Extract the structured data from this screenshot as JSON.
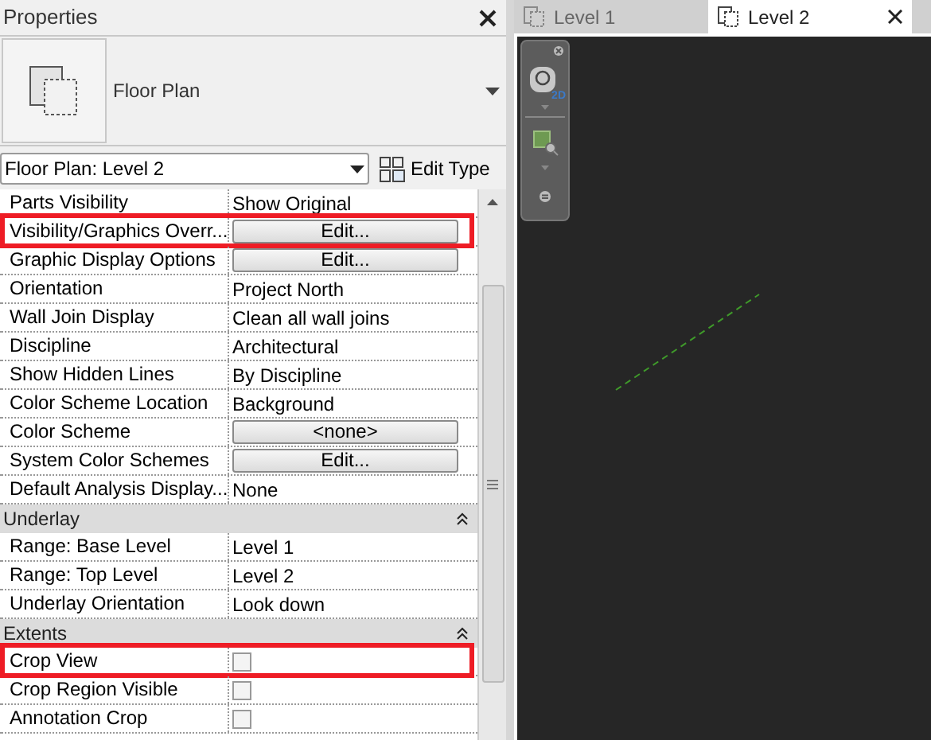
{
  "properties_panel": {
    "title": "Properties",
    "type_selector": {
      "label": "Floor Plan"
    },
    "instance_dropdown": {
      "value": "Floor Plan: Level 2"
    },
    "edit_type": "Edit Type",
    "sections": [
      {
        "rows": [
          {
            "name": "Parts Visibility",
            "kind": "text",
            "value": "Show Original",
            "highlighted": false
          },
          {
            "name": "Visibility/Graphics Overr...",
            "kind": "button",
            "value": "Edit...",
            "highlighted": true
          },
          {
            "name": "Graphic Display Options",
            "kind": "button",
            "value": "Edit...",
            "highlighted": false
          },
          {
            "name": "Orientation",
            "kind": "text",
            "value": "Project North",
            "highlighted": false
          },
          {
            "name": "Wall Join Display",
            "kind": "text",
            "value": "Clean all wall joins",
            "highlighted": false
          },
          {
            "name": "Discipline",
            "kind": "text",
            "value": "Architectural",
            "highlighted": false
          },
          {
            "name": "Show Hidden Lines",
            "kind": "text",
            "value": "By Discipline",
            "highlighted": false
          },
          {
            "name": "Color Scheme Location",
            "kind": "text",
            "value": "Background",
            "highlighted": false
          },
          {
            "name": "Color Scheme",
            "kind": "button",
            "value": "<none>",
            "highlighted": false
          },
          {
            "name": "System Color Schemes",
            "kind": "button",
            "value": "Edit...",
            "highlighted": false
          },
          {
            "name": "Default Analysis Display...",
            "kind": "text",
            "value": "None",
            "highlighted": false
          }
        ]
      },
      {
        "title": "Underlay",
        "expanded": true,
        "rows": [
          {
            "name": "Range: Base Level",
            "kind": "text",
            "value": "Level 1",
            "highlighted": false
          },
          {
            "name": "Range: Top Level",
            "kind": "text",
            "value": "Level 2",
            "highlighted": false
          },
          {
            "name": "Underlay Orientation",
            "kind": "text",
            "value": "Look down",
            "highlighted": false
          }
        ]
      },
      {
        "title": "Extents",
        "expanded": true,
        "rows": [
          {
            "name": "Crop View",
            "kind": "checkbox",
            "checked": false,
            "highlighted": true
          },
          {
            "name": "Crop Region Visible",
            "kind": "checkbox",
            "checked": false,
            "highlighted": false
          },
          {
            "name": "Annotation Crop",
            "kind": "checkbox",
            "checked": false,
            "highlighted": false
          }
        ]
      }
    ]
  },
  "view_tabs": [
    {
      "label": "Level 1",
      "selected": false
    },
    {
      "label": "Level 2",
      "selected": true
    }
  ],
  "navigation_bar": {
    "wheel_badge": "2D"
  }
}
